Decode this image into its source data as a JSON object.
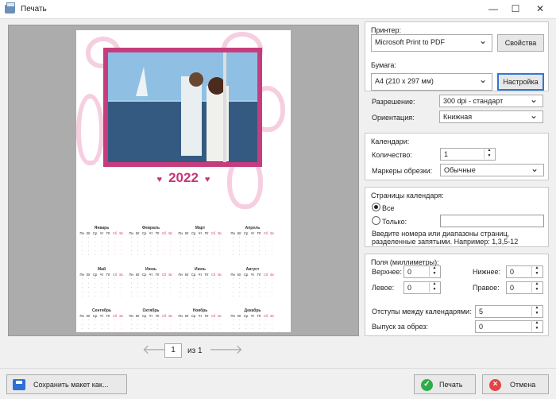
{
  "window": {
    "title": "Печать",
    "minimize": "—",
    "maximize": "☐",
    "close": "✕"
  },
  "preview": {
    "year": "2022",
    "heart": "♥",
    "page_number": "1",
    "of_text": "из 1",
    "prev": "🡐",
    "next": "🡒"
  },
  "calendar": {
    "weekdays": [
      "Пн",
      "Вт",
      "Ср",
      "Чт",
      "Пт",
      "Сб",
      "Вс"
    ],
    "months": [
      "Январь",
      "Февраль",
      "Март",
      "Апрель",
      "Май",
      "Июнь",
      "Июль",
      "Август",
      "Сентябрь",
      "Октябрь",
      "Ноябрь",
      "Декабрь"
    ]
  },
  "printer": {
    "section": "Принтер:",
    "name": "Microsoft Print to PDF",
    "properties": "Свойства"
  },
  "paper": {
    "section": "Бумага:",
    "size": "A4 (210 x 297 мм)",
    "setup": "Настройка",
    "resolution_label": "Разрешение:",
    "resolution": "300 dpi - стандарт",
    "orientation_label": "Ориентация:",
    "orientation": "Книжная"
  },
  "calendars": {
    "section": "Календари:",
    "count_label": "Количество:",
    "count": "1",
    "crop_label": "Маркеры обрезки:",
    "crop": "Обычные"
  },
  "pages": {
    "section": "Страницы календаря:",
    "all": "Все",
    "only": "Только:",
    "hint": "Введите номера или диапазоны страниц, разделенные запятыми. Например: 1,3,5-12"
  },
  "margins": {
    "section": "Поля (миллиметры):",
    "top_label": "Верхнее:",
    "top": "0",
    "bottom_label": "Нижнее:",
    "bottom": "0",
    "left_label": "Левое:",
    "left": "0",
    "right_label": "Правое:",
    "right": "0",
    "gap_label": "Отступы между календарями:",
    "gap": "5",
    "bleed_label": "Выпуск за обрез:",
    "bleed": "0"
  },
  "actions": {
    "save": "Сохранить макет как...",
    "print": "Печать",
    "cancel": "Отмена"
  },
  "colors": {
    "accent": "#c9357a",
    "print_ok": "#2fac4a",
    "cancel": "#e34444"
  }
}
